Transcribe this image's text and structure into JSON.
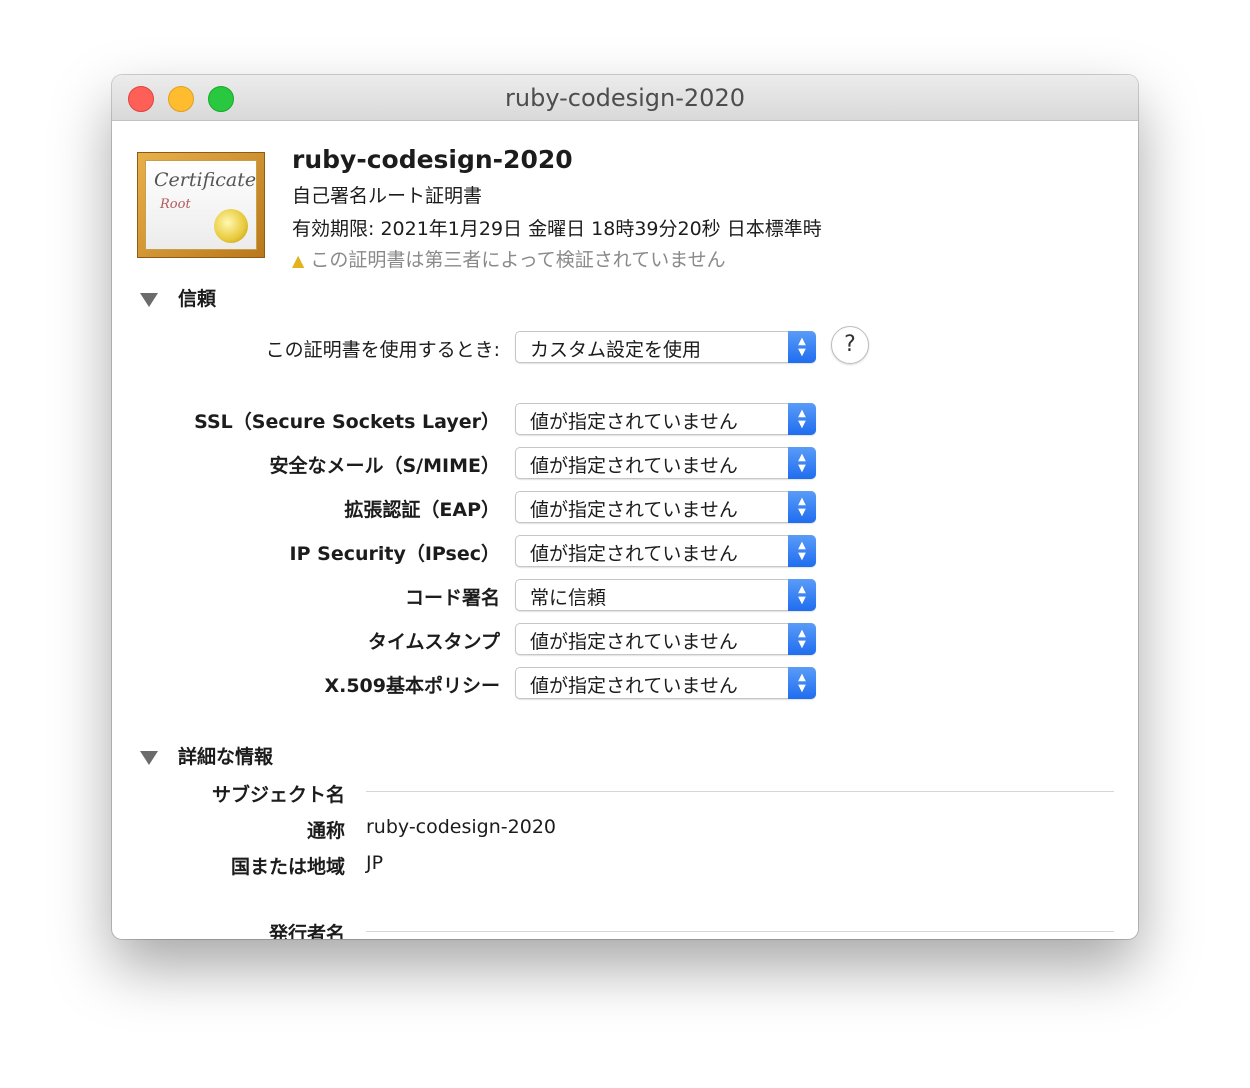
{
  "window": {
    "title": "ruby-codesign-2020"
  },
  "certificate": {
    "icon": {
      "script_text": "Certificate",
      "root_text": "Root"
    },
    "name": "ruby-codesign-2020",
    "type": "自己署名ルート証明書",
    "expiry": "有効期限: 2021年1月29日 金曜日 18時39分20秒 日本標準時",
    "warning": "この証明書は第三者によって検証されていません"
  },
  "trust": {
    "header": "信頼",
    "when_using": {
      "label": "この証明書を使用するとき:",
      "value": "カスタム設定を使用"
    },
    "help_label": "?",
    "rows": [
      {
        "label": "SSL（Secure Sockets Layer）",
        "value": "値が指定されていません"
      },
      {
        "label": "安全なメール（S/MIME）",
        "value": "値が指定されていません"
      },
      {
        "label": "拡張認証（EAP）",
        "value": "値が指定されていません"
      },
      {
        "label": "IP Security（IPsec）",
        "value": "値が指定されていません"
      },
      {
        "label": "コード署名",
        "value": "常に信頼"
      },
      {
        "label": "タイムスタンプ",
        "value": "値が指定されていません"
      },
      {
        "label": "X.509基本ポリシー",
        "value": "値が指定されていません"
      }
    ]
  },
  "details": {
    "header": "詳細な情報",
    "subject_name": "サブジェクト名",
    "fields": [
      {
        "label": "通称",
        "value": "ruby-codesign-2020"
      },
      {
        "label": "国または地域",
        "value": "JP"
      }
    ],
    "issuer_name": "発行者名"
  },
  "colors": {
    "accent": "#1f6df0",
    "warning": "#e3b21c"
  }
}
